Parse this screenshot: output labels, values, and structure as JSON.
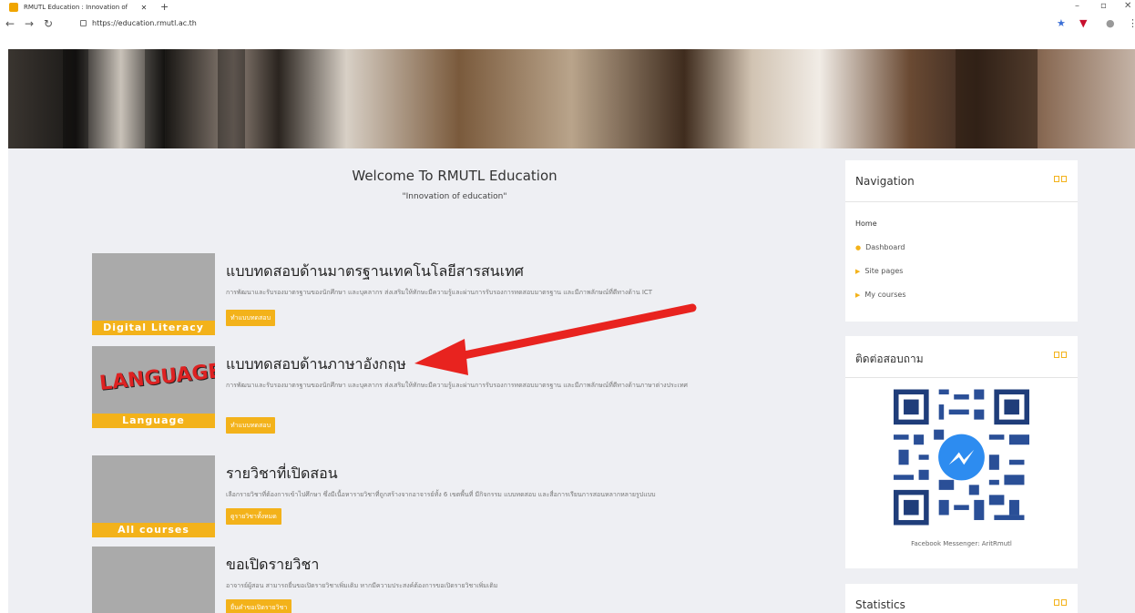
{
  "browser": {
    "tab_title": "RMUTL Education : Innovation of",
    "new_tab": "+",
    "url": "https://education.rmutl.ac.th",
    "minimize": "–",
    "restore": "▫",
    "close": "✕"
  },
  "welcome": {
    "title": "Welcome To RMUTL Education",
    "tagline": "\"Innovation of education\""
  },
  "courses": [
    {
      "title": "แบบทดสอบด้านมาตรฐานเทคโนโลยีสารสนเทศ",
      "desc": "การพัฒนาและรับรองมาตรฐานของนักศึกษา และบุคลากร ส่งเสริมให้ทักษะมีความรู้และผ่านการรับรองการทดสอบมาตรฐาน และมีภาพลักษณ์ที่ดีทางด้าน ICT",
      "button": "ทำแบบทดสอบ",
      "thumb_caption": "Digital Literacy"
    },
    {
      "title": "แบบทดสอบด้านภาษาอังกฤษ",
      "desc": "การพัฒนาและรับรองมาตรฐานของนักศึกษา และบุคลากร ส่งเสริมให้ทักษะมีความรู้และผ่านการรับรองการทดสอบมาตรฐาน และมีภาพลักษณ์ที่ดีทางด้านภาษาต่างประเทศ",
      "button": "ทำแบบทดสอบ",
      "thumb_caption": "Language",
      "thumb_word": "LANGUAGE"
    },
    {
      "title": "รายวิชาที่เปิดสอน",
      "desc": "เลือกรายวิชาที่ต้องการเข้าไปศึกษา ซึ่งมีเนื้อหารายวิชาที่ถูกสร้างจากอาจารย์ทั้ง 6 เขตพื้นที่ มีกิจกรรม แบบทดสอบ และสื่อการเรียนการสอนหลากหลายรูปแบบ",
      "button": "ดูรายวิชาทั้งหมด",
      "thumb_caption": "All courses"
    },
    {
      "title": "ขอเปิดรายวิชา",
      "desc": "อาจารย์ผู้สอน สามารถยื่นขอเปิดรายวิชาเพิ่มเติม หากมีความประสงค์ต้องการขอเปิดรายวิชาเพิ่มเติม",
      "button": "ยื่นคำขอเปิดรายวิชา"
    }
  ],
  "navigation": {
    "title": "Navigation",
    "home": "Home",
    "items": [
      "Dashboard",
      "Site pages",
      "My courses"
    ]
  },
  "contact": {
    "title": "ติดต่อสอบถาม",
    "caption": "Facebook Messenger: AritRmutl"
  },
  "statistics": {
    "title": "Statistics"
  },
  "colors": {
    "accent": "#f3b21a",
    "arrow": "#e8231f"
  }
}
